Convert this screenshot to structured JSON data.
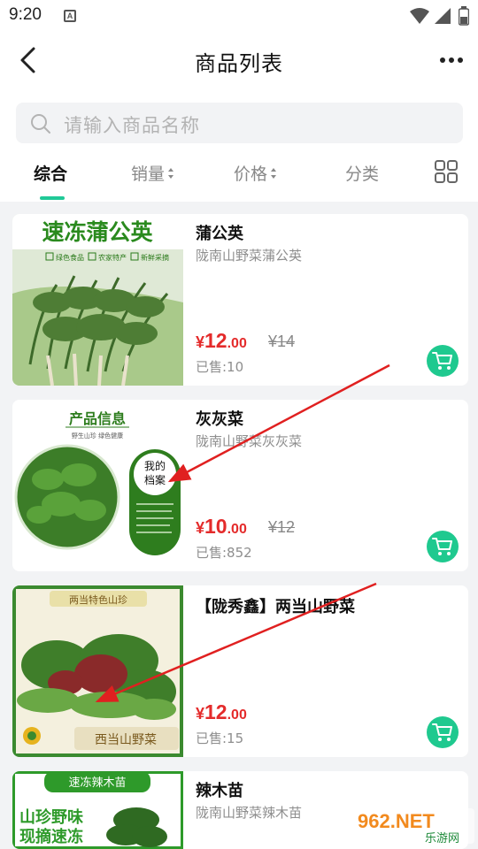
{
  "status_bar": {
    "time": "9:20",
    "notif_icon": "A"
  },
  "navbar": {
    "title": "商品列表"
  },
  "search": {
    "placeholder": "请输入商品名称"
  },
  "tabs": [
    {
      "label": "综合",
      "active": true
    },
    {
      "label": "销量",
      "sortable": true
    },
    {
      "label": "价格",
      "sortable": true
    },
    {
      "label": "分类"
    }
  ],
  "products": [
    {
      "name": "蒲公英",
      "desc": "陇南山野菜蒲公英",
      "price_symbol": "¥",
      "price_int": "12",
      "price_dec": ".00",
      "orig_price": "¥14",
      "sold": "已售:10",
      "image_text": "速冻蒲公英",
      "image_tags": [
        "绿色食品",
        "农家特产",
        "新鲜采摘"
      ]
    },
    {
      "name": "灰灰菜",
      "desc": "陇南山野菜灰灰菜",
      "price_symbol": "¥",
      "price_int": "10",
      "price_dec": ".00",
      "orig_price": "¥12",
      "sold": "已售:852",
      "image_text": "产品信息",
      "image_sub": "野生山珍 绿色健康",
      "image_badge": "我的档案"
    },
    {
      "name": "【陇秀鑫】两当山野菜",
      "desc": "",
      "price_symbol": "¥",
      "price_int": "12",
      "price_dec": ".00",
      "orig_price": "",
      "sold": "已售:15",
      "image_text": "西当山野菜"
    },
    {
      "name": "辣木苗",
      "desc": "陇南山野菜辣木苗",
      "price_symbol": "",
      "price_int": "",
      "price_dec": "",
      "orig_price": "",
      "sold": "",
      "image_text": "速冻辣木苗",
      "image_sub": "山珍野味"
    }
  ],
  "colors": {
    "accent": "#20c997",
    "price": "#e42b2b",
    "cart": "#1fc98f"
  },
  "watermark": {
    "text": "962.NET",
    "sub": "乐游网"
  }
}
